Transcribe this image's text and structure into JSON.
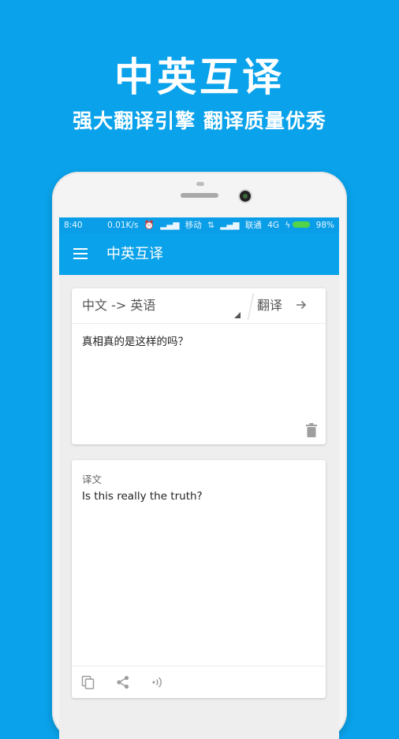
{
  "promo": {
    "title": "中英互译",
    "subtitle": "强大翻译引擎  翻译质量优秀"
  },
  "status_bar": {
    "time": "8:40",
    "speed": "0.01K/s",
    "carrier1": "移动",
    "carrier2": "联通",
    "network": "4G",
    "battery": "98%",
    "icons": [
      "alarm-icon",
      "signal-icon",
      "data-arrows-icon",
      "charging-icon",
      "battery-icon"
    ]
  },
  "app_bar": {
    "title": "中英互译",
    "menu_icon": "hamburger-menu-icon"
  },
  "input_card": {
    "language_pair": "中文 -> 英语",
    "translate_label": "翻译",
    "source_text": "真相真的是这样的吗？",
    "icons": [
      "dropdown-triangle-icon",
      "arrow-right-icon",
      "trash-icon"
    ]
  },
  "output_card": {
    "label": "译文",
    "translated_text": "Is this really the truth?",
    "icons": [
      "copy-icon",
      "share-icon",
      "speaker-icon"
    ]
  },
  "colors": {
    "background": "#0aa2ea",
    "app_bar": "#0aa2ea",
    "status_bar": "#0a9ee8",
    "card": "#ffffff",
    "battery": "#53d34a"
  }
}
